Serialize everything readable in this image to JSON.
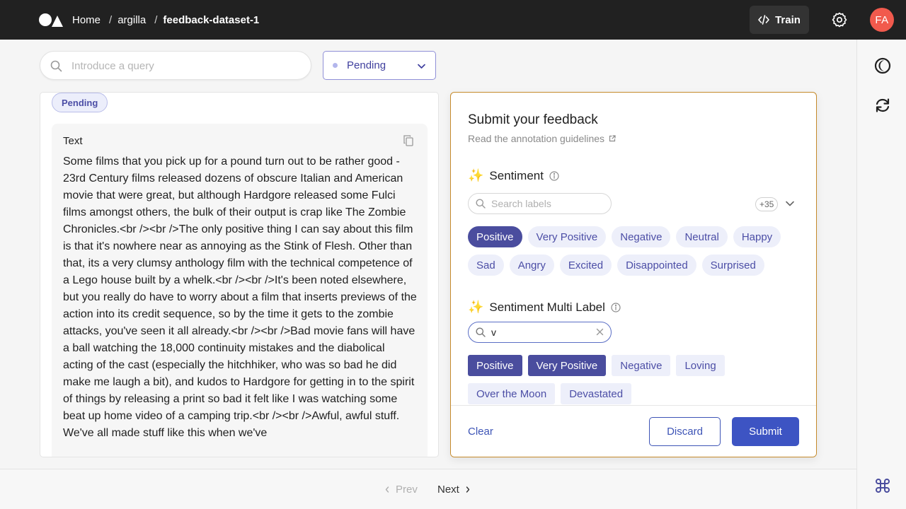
{
  "header": {
    "breadcrumb": [
      "Home",
      "argilla",
      "feedback-dataset-1"
    ],
    "train_label": "Train",
    "avatar_initials": "FA",
    "avatar_color": "#f15a4d"
  },
  "toolbar": {
    "search_placeholder": "Introduce a query",
    "status_filter": "Pending"
  },
  "record": {
    "status_badge": "Pending",
    "field_title": "Text",
    "field_text": "Some films that you pick up for a pound turn out to be rather good - 23rd Century films released dozens of obscure Italian and American movie that were great, but although Hardgore released some Fulci films amongst others, the bulk of their output is crap like The Zombie Chronicles.<br /><br />The only positive thing I can say about this film is that it's nowhere near as annoying as the Stink of Flesh. Other than that, its a very clumsy anthology film with the technical competence of a Lego house built by a whelk.<br /><br />It's been noted elsewhere, but you really do have to worry about a film that inserts previews of the action into its credit sequence, so by the time it gets to the zombie attacks, you've seen it all already.<br /><br />Bad movie fans will have a ball watching the 18,000 continuity mistakes and the diabolical acting of the cast (especially the hitchhiker, who was so bad he did make me laugh a bit), and kudos to Hardgore for getting in to the spirit of things by releasing a print so bad it felt like I was watching some beat up home video of a camping trip.<br /><br />Awful, awful stuff. We've all made stuff like this when we've"
  },
  "feedback": {
    "title": "Submit your feedback",
    "guidelines_link": "Read the annotation guidelines",
    "questions": [
      {
        "label": "Sentiment",
        "search_placeholder": "Search labels",
        "search_value": "",
        "more_count": "+35",
        "options": [
          {
            "label": "Positive",
            "selected": true
          },
          {
            "label": "Very Positive",
            "selected": false
          },
          {
            "label": "Negative",
            "selected": false
          },
          {
            "label": "Neutral",
            "selected": false
          },
          {
            "label": "Happy",
            "selected": false
          },
          {
            "label": "Sad",
            "selected": false
          },
          {
            "label": "Angry",
            "selected": false
          },
          {
            "label": "Excited",
            "selected": false
          },
          {
            "label": "Disappointed",
            "selected": false
          },
          {
            "label": "Surprised",
            "selected": false
          }
        ]
      },
      {
        "label": "Sentiment Multi Label",
        "search_placeholder": "",
        "search_value": "v",
        "options": [
          {
            "label": "Positive",
            "selected": true
          },
          {
            "label": "Very Positive",
            "selected": true
          },
          {
            "label": "Negative",
            "selected": false
          },
          {
            "label": "Loving",
            "selected": false
          },
          {
            "label": "Over the Moon",
            "selected": false
          },
          {
            "label": "Devastated",
            "selected": false
          }
        ]
      }
    ],
    "clear_label": "Clear",
    "discard_label": "Discard",
    "submit_label": "Submit"
  },
  "pagination": {
    "prev_label": "Prev",
    "next_label": "Next"
  },
  "icons": {
    "logo": "argilla-logo",
    "train": "code-icon",
    "settings": "gear-icon",
    "theme": "contrast-icon",
    "refresh": "refresh-icon",
    "shortcuts": "command-icon"
  },
  "colors": {
    "accent": "#3d54c3",
    "chip_bg": "#edeffa",
    "chip_selected": "#4a4d9e",
    "panel_border": "#c58a2b",
    "topbar": "#212121"
  }
}
